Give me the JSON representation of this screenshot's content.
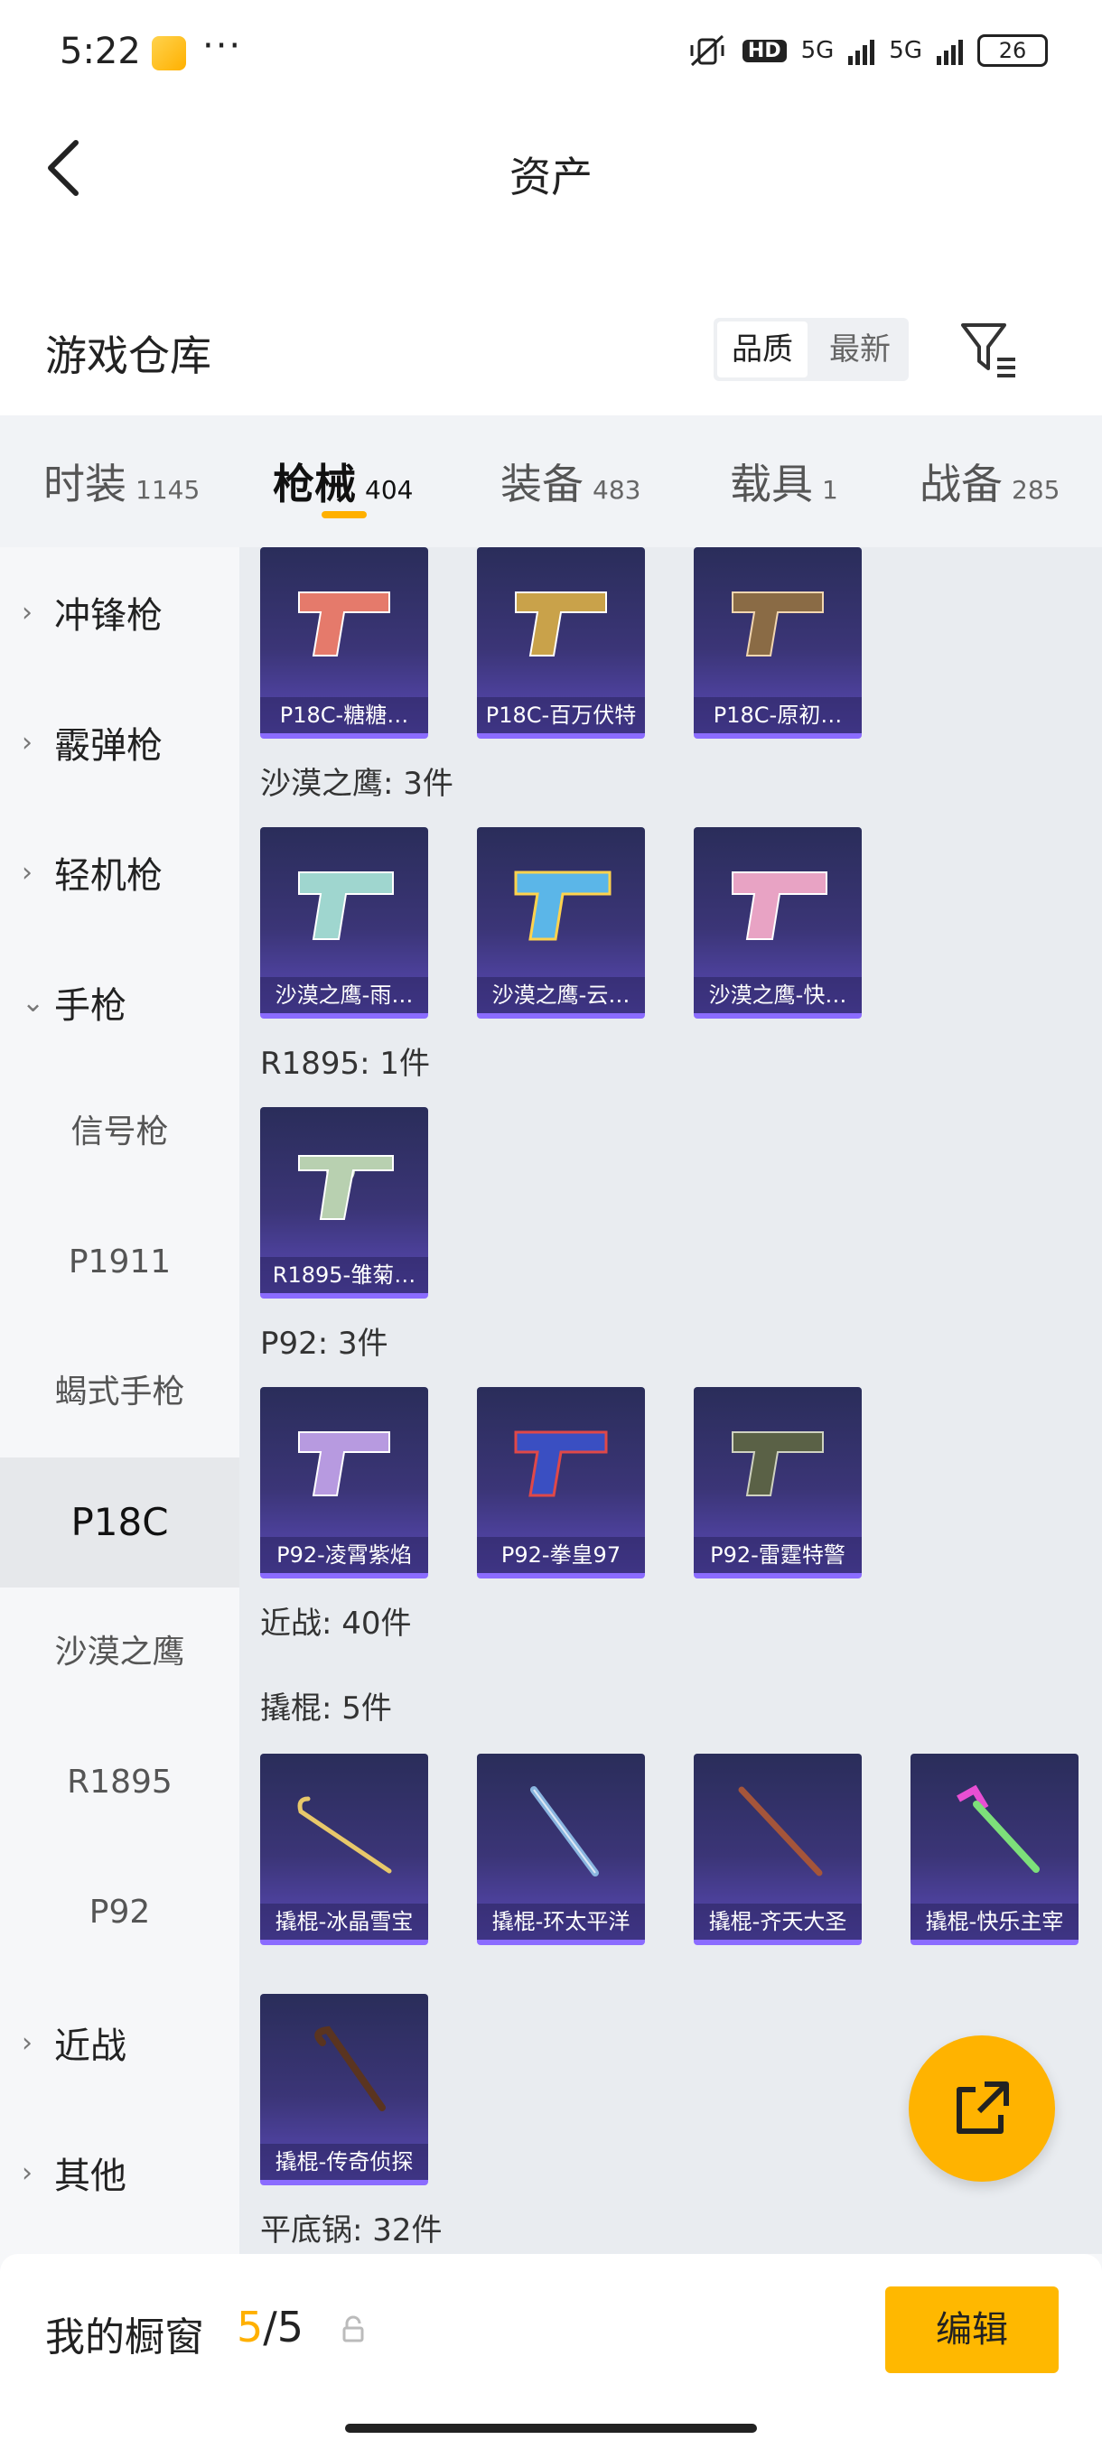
{
  "status_bar": {
    "time": "5:22",
    "dots": "···",
    "hd": "HD",
    "network1": "5G",
    "network2": "5G",
    "battery": "26"
  },
  "nav": {
    "title": "资产"
  },
  "warehouse": {
    "title": "游戏仓库",
    "sort_options": [
      "品质",
      "最新"
    ]
  },
  "tabs": [
    {
      "label": "时装",
      "count": "1145"
    },
    {
      "label": "枪械",
      "count": "404"
    },
    {
      "label": "装备",
      "count": "483"
    },
    {
      "label": "载具",
      "count": "1"
    },
    {
      "label": "战备",
      "count": "285"
    }
  ],
  "sidebar": {
    "groups": [
      "冲锋枪",
      "霰弹枪",
      "轻机枪",
      "手枪"
    ],
    "subitems": [
      "信号枪",
      "P1911",
      "蝎式手枪",
      "P18C",
      "沙漠之鹰",
      "R1895",
      "P92"
    ],
    "bottom_groups": [
      "近战",
      "其他"
    ]
  },
  "content": {
    "p18c_items": [
      "P18C-糖糖…",
      "P18C-百万伏特",
      "P18C-原初…"
    ],
    "deagle_title": "沙漠之鹰: 3件",
    "deagle_items": [
      "沙漠之鹰-雨…",
      "沙漠之鹰-云…",
      "沙漠之鹰-快…"
    ],
    "r1895_title": "R1895: 1件",
    "r1895_items": [
      "R1895-雏菊…"
    ],
    "p92_title": "P92: 3件",
    "p92_items": [
      "P92-凌霄紫焰",
      "P92-拳皇97",
      "P92-雷霆特警"
    ],
    "melee_title": "近战: 40件",
    "crowbar_title": "撬棍: 5件",
    "crowbar_items": [
      "撬棍-冰晶雪宝",
      "撬棍-环太平洋",
      "撬棍-齐天大圣",
      "撬棍-快乐主宰",
      "撬棍-传奇侦探"
    ],
    "pan_title": "平底锅: 32件"
  },
  "bottom": {
    "showcase_label": "我的橱窗",
    "count_current": "5",
    "count_sep": "/",
    "count_total": "5",
    "edit_label": "编辑"
  },
  "colors": {
    "accent": "#ffb000",
    "card_top": "#2a2d5a",
    "card_bottom": "#5a4ab8"
  }
}
